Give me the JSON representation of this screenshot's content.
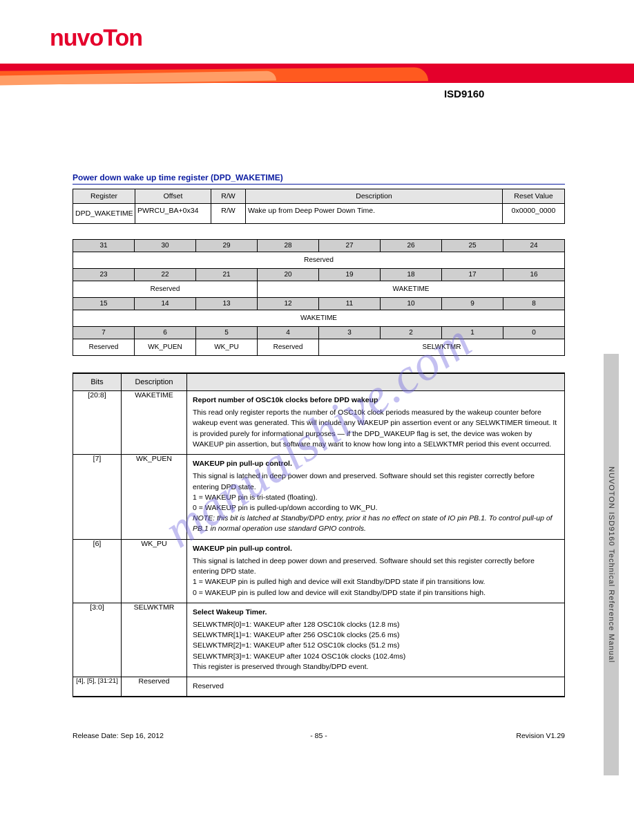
{
  "header": {
    "brand": "nuvoTon",
    "docname": "ISD9160"
  },
  "section_title": "Power down wake up time register (DPD_WAKETIME)",
  "reg_table": {
    "headers": [
      "Register",
      "Offset",
      "R/W",
      "Description",
      "Reset Value"
    ],
    "row": {
      "register": "DPD_WAKETIME",
      "offset": "PWRCU_BA+0x34",
      "rw": "R/W",
      "description": "Wake up from Deep Power Down Time.",
      "reset": "0x0000_0000"
    }
  },
  "bit_table": {
    "r1": [
      "31",
      "30",
      "29",
      "28",
      "27",
      "26",
      "25",
      "24"
    ],
    "l1": "Reserved",
    "r2": [
      "23",
      "22",
      "21",
      "20",
      "19",
      "18",
      "17",
      "16"
    ],
    "l2a": "Reserved",
    "l2b": "WAKETIME",
    "r3": [
      "15",
      "14",
      "13",
      "12",
      "11",
      "10",
      "9",
      "8"
    ],
    "l3": "WAKETIME",
    "r4": [
      "7",
      "6",
      "5",
      "4",
      "3",
      "2",
      "1",
      "0"
    ],
    "l4a": "Reserved",
    "l4b": "WK_PUEN",
    "l4c": "WK_PU",
    "l4d": "Reserved",
    "l4e": "SELWKTMR"
  },
  "desc_table": {
    "headers": [
      "Bits",
      "Description",
      ""
    ],
    "rows": [
      {
        "bits": "[20:8]",
        "field": "WAKETIME",
        "title": "Report number of OSC10k clocks before DPD wakeup",
        "body": "This read only register reports the number of OSC10k clock periods measured by the wakeup counter before wakeup event was generated. This will include any WAKEUP pin assertion event or any SELWKTIMER timeout. It is provided purely for informational purposes — if the DPD_WAKEUP flag is set, the device was woken by WAKEUP pin assertion, but software may want to know how long into a SELWKTMR period this event occurred."
      },
      {
        "bits": "[7]",
        "field": "WK_PUEN",
        "title": "WAKEUP pin pull-up control.",
        "body": "This signal is latched in deep power down and preserved. Software should set this register correctly before entering DPD state.<br>1 = WAKEUP pin is tri-stated (floating).<br>0 = WAKEUP pin is pulled-up/down according to WK_PU.<br><i>NOTE: this bit is latched at Standby/DPD entry, prior it has no effect on state of IO pin PB.1. To control pull-up of PB.1 in normal operation use standard GPIO controls.</i>"
      },
      {
        "bits": "[6]",
        "field": "WK_PU",
        "title": "WAKEUP pin pull-up control.",
        "body": "This signal is latched in deep power down and preserved. Software should set this register correctly before entering DPD state.<br>1 = WAKEUP pin is pulled high and device will exit Standby/DPD state if pin transitions low.<br>0 = WAKEUP pin is pulled low and device will exit Standby/DPD state if pin transitions high."
      },
      {
        "bits": "[3:0]",
        "field": "SELWKTMR",
        "title": "Select Wakeup Timer.",
        "body": "SELWKTMR[0]=1: WAKEUP after 128 OSC10k clocks (12.8 ms)<br>SELWKTMR[1]=1: WAKEUP after 256 OSC10k clocks (25.6 ms)<br>SELWKTMR[2]=1: WAKEUP after 512 OSC10k clocks (51.2 ms)<br>SELWKTMR[3]=1: WAKEUP after 1024 OSC10k clocks (102.4ms)<br>This register is preserved through Standby/DPD event."
      },
      {
        "bits": "[4], [5], [31:21]",
        "field": "Reserved",
        "title": "Reserved",
        "body": ""
      }
    ]
  },
  "side_label": "NUVOTON ISD9160 Technical Reference Manual",
  "footer": {
    "left": "Release Date: Sep 16, 2012",
    "center": "- 85 -",
    "right": "Revision V1.29"
  },
  "watermark": "manualshive.com"
}
